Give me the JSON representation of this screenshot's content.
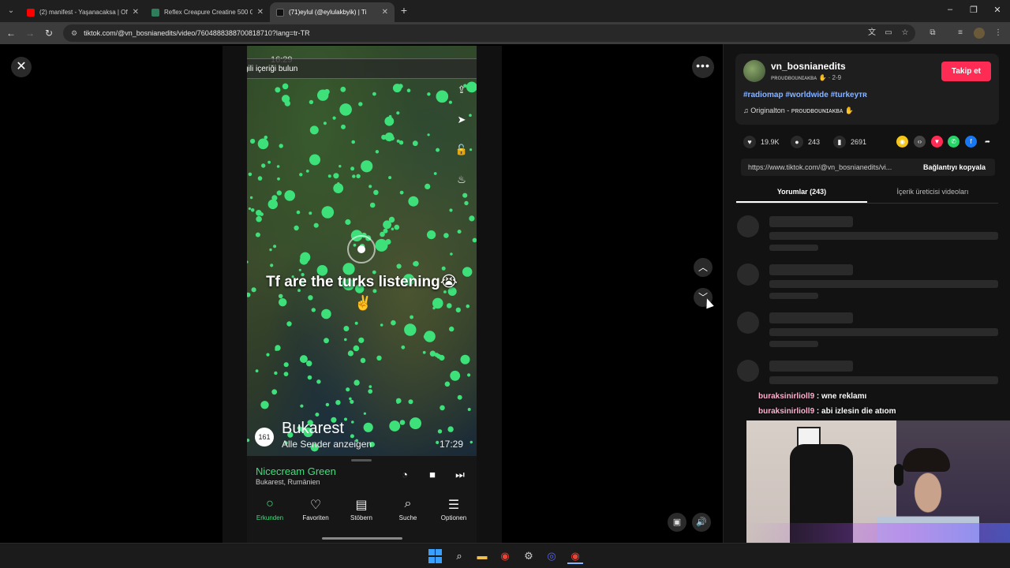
{
  "browser": {
    "tabs": [
      {
        "title": "(2) manifest - Yaşanacaksa | Off",
        "fav_color": "#ff0000",
        "icon": "youtube-icon"
      },
      {
        "title": "Reflex Creapure Creatine 500 G",
        "fav_color": "#2e7d5b",
        "icon": "shop-icon"
      },
      {
        "title": "(71)eylul (@eylulakbyik) | Ti",
        "fav_color": "#111111",
        "icon": "tiktok-icon",
        "active": true
      }
    ],
    "url": "tiktok.com/@vn_bosnianedits/video/7604888388700818710?lang=tr-TR"
  },
  "video": {
    "search_placeholder": "İlgili içeriği bulun",
    "clock_top": "16:29",
    "caption": "Tf are the turks listening😭",
    "peace_emoji": "✌️",
    "station_count": "161",
    "city": "Bukarest",
    "city_sub": "Alle Sender anzeigen",
    "time": "17:29",
    "song": "Nicecream Green",
    "song_sub": "Bukarest, Rumänien",
    "nav": [
      {
        "label": "Erkunden",
        "icon": "compass-icon",
        "active": true
      },
      {
        "label": "Favoriten",
        "icon": "heart-icon"
      },
      {
        "label": "Stöbern",
        "icon": "map-icon"
      },
      {
        "label": "Suche",
        "icon": "search-icon"
      },
      {
        "label": "Optionen",
        "icon": "menu-icon"
      }
    ]
  },
  "panel": {
    "username": "vn_bosnianedits",
    "user_sub": "ᴘʀᴏᴜᴅʙᴏᴜɴɪᴀᴋʙᴀ ✋ · 2-9",
    "follow_label": "Takip et",
    "hashtags": "#radiomap #worldwide #turkeyᴛʀ",
    "sound": "♫  Originalton - ᴘʀᴏᴜᴅʙᴏᴜɴɪᴀᴋʙᴀ ✋",
    "likes": "19.9K",
    "comments": "243",
    "saves": "2691",
    "link_url": "https://www.tiktok.com/@vn_bosnianedits/vi...",
    "copy_label": "Bağlantıyı kopyala",
    "tab_comments": "Yorumlar (243)",
    "tab_creator": "İçerik üreticisi videoları"
  },
  "chat": [
    {
      "user": "buraksinirlioll9",
      "msg": " : wne reklamı"
    },
    {
      "user": "buraksinirlioll9",
      "msg": " : abi izlesin die atıom"
    }
  ],
  "colors": {
    "accent": "#fe2c55",
    "radio_green": "#3ee07a",
    "hashtag": "#8ab4ff"
  }
}
